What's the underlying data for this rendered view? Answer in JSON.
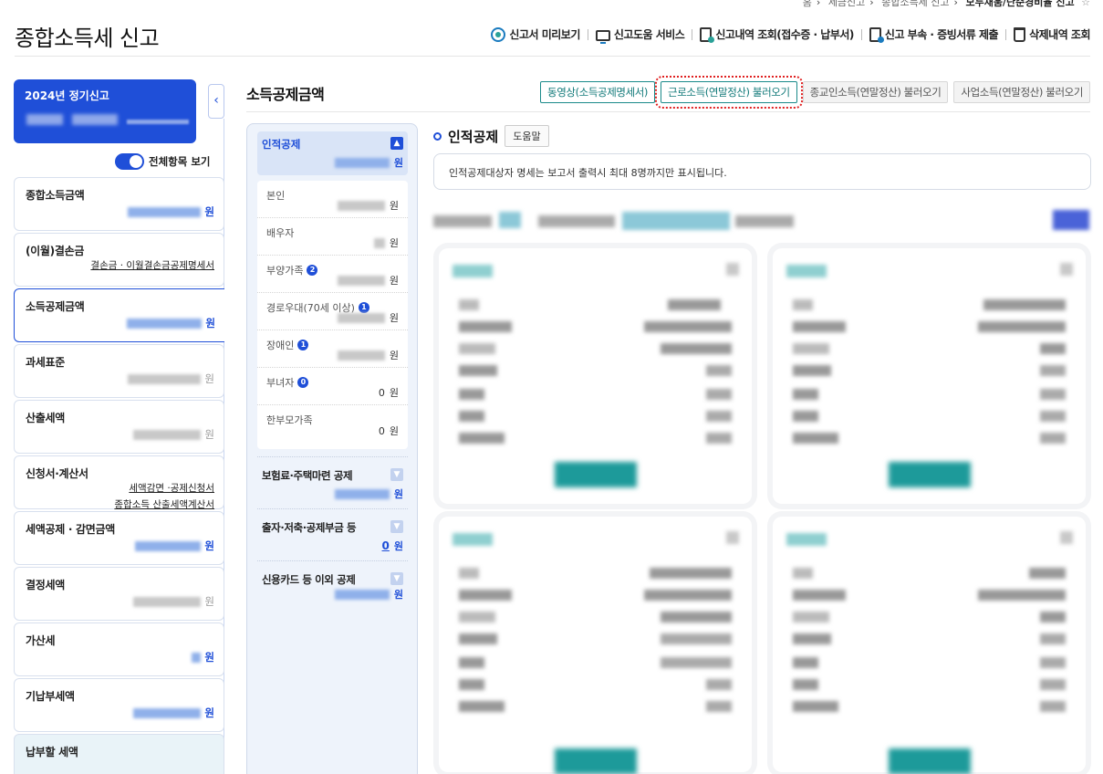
{
  "breadcrumb": {
    "items": [
      "홈",
      "세금신고",
      "종합소득세 신고"
    ],
    "current": "모두채움/단순경비율 신고"
  },
  "page_title": "종합소득세 신고",
  "top_menu": [
    {
      "label": "신고서 미리보기",
      "icon": "check-circle-icon"
    },
    {
      "label": "신고도움 서비스",
      "icon": "monitor-icon"
    },
    {
      "label": "신고내역 조회(접수증 · 납부서)",
      "icon": "document-search-icon"
    },
    {
      "label": "신고 부속 · 증빙서류 제출",
      "icon": "document-upload-icon"
    },
    {
      "label": "삭제내역 조회",
      "icon": "trash-icon"
    }
  ],
  "sidebar": {
    "header_title": "2024년 정기신고",
    "toggle_label": "전체항목 보기",
    "items": [
      {
        "label": "종합소득금액",
        "unit": "원"
      },
      {
        "label": "(이월)결손금",
        "links": [
          "결손금 · 이월결손금공제명세서"
        ]
      },
      {
        "label": "소득공제금액",
        "unit": "원"
      },
      {
        "label": "과세표준",
        "unit": "원"
      },
      {
        "label": "산출세액",
        "unit": "원"
      },
      {
        "label": "신청서·계산서",
        "links": [
          "세액감면 ·공제신청서",
          "종합소득 산출세액계산서"
        ]
      },
      {
        "label": "세액공제 · 감면금액",
        "unit": "원"
      },
      {
        "label": "결정세액",
        "unit": "원"
      },
      {
        "label": "가산세",
        "unit": "원"
      },
      {
        "label": "기납부세액",
        "unit": "원"
      },
      {
        "label": "납부할 세액"
      }
    ]
  },
  "main": {
    "title": "소득공제금액",
    "buttons": [
      "동영상(소득공제명세서)",
      "근로소득(연말정산) 불러오기",
      "종교인소득(연말정산) 불러오기",
      "사업소득(연말정산) 불러오기"
    ]
  },
  "inner_nav": {
    "active_section": {
      "label": "인적공제",
      "unit": "원"
    },
    "sub_items": [
      {
        "label": "본인",
        "unit": "원"
      },
      {
        "label": "배우자",
        "unit": "원"
      },
      {
        "label": "부양가족",
        "badge": "2",
        "unit": "원"
      },
      {
        "label": "경로우대(70세 이상)",
        "badge": "1",
        "unit": "원"
      },
      {
        "label": "장애인",
        "badge": "1",
        "unit": "원"
      },
      {
        "label": "부녀자",
        "badge": "0",
        "value": "0",
        "unit": "원"
      },
      {
        "label": "한부모가족",
        "value": "0",
        "unit": "원"
      }
    ],
    "sections": [
      {
        "label": "보험료·주택마련 공제",
        "unit": "원"
      },
      {
        "label": "출자·저축·공제부금 등",
        "value": "0",
        "unit": "원"
      },
      {
        "label": "신용카드 등 이외 공제",
        "unit": "원"
      }
    ]
  },
  "detail": {
    "section_title": "인적공제",
    "help_label": "도움말",
    "info_text": "인적공제대상자 명세는 보고서 출력시 최대 8명까지만 표시됩니다."
  },
  "colors": {
    "primary": "#1f4fd8",
    "teal": "#1a8a8a",
    "highlight": "#e02020"
  }
}
